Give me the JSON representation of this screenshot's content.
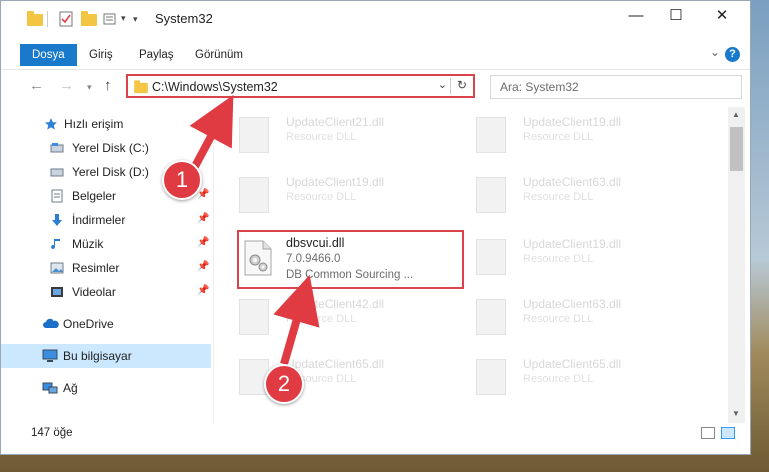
{
  "window": {
    "title": "System32",
    "minimize": "—",
    "maximize": "☐",
    "close": "✕"
  },
  "ribbon": {
    "tabs": [
      {
        "label": "Dosya",
        "active": true
      },
      {
        "label": "Giriş"
      },
      {
        "label": "Paylaş"
      },
      {
        "label": "Görünüm"
      }
    ],
    "help": "?"
  },
  "address": {
    "path": "C:\\Windows\\System32",
    "search_placeholder": "Ara: System32"
  },
  "sidebar": {
    "items": [
      {
        "label": "Hızlı erişim",
        "icon": "star-icon"
      },
      {
        "label": "Yerel Disk (C:)",
        "icon": "drive-icon"
      },
      {
        "label": "Yerel Disk (D:)",
        "icon": "drive-icon"
      },
      {
        "label": "Belgeler",
        "icon": "documents-icon",
        "pinned": true
      },
      {
        "label": "İndirmeler",
        "icon": "download-icon",
        "pinned": true
      },
      {
        "label": "Müzik",
        "icon": "music-icon",
        "pinned": true
      },
      {
        "label": "Resimler",
        "icon": "pictures-icon",
        "pinned": true
      },
      {
        "label": "Videolar",
        "icon": "videos-icon",
        "pinned": true
      },
      {
        "label": "OneDrive",
        "icon": "cloud-icon"
      },
      {
        "label": "Bu bilgisayar",
        "icon": "computer-icon",
        "selected": true
      },
      {
        "label": "Ağ",
        "icon": "network-icon"
      }
    ]
  },
  "files": {
    "left": [
      {
        "name": "UpdateClient21.dll",
        "desc": "Resource DLL"
      },
      {
        "name": "UpdateClient19.dll",
        "desc": "Resource DLL"
      },
      {
        "name": "dbsvcui.dll",
        "version": "7.0.9466.0",
        "desc": "DB Common Sourcing ...",
        "focus": true
      },
      {
        "name": "UpdateClient42.dll",
        "desc": "Resource DLL"
      },
      {
        "name": "UpdateClient65.dll",
        "desc": "Resource DLL"
      }
    ],
    "right": [
      {
        "name": "UpdateClient19.dll",
        "desc": "Resource DLL"
      },
      {
        "name": "UpdateClient63.dll",
        "desc": "Resource DLL"
      },
      {
        "name": "UpdateClient19.dll",
        "desc": "Resource DLL"
      },
      {
        "name": "UpdateClient63.dll",
        "desc": "Resource DLL"
      },
      {
        "name": "UpdateClient65.dll",
        "desc": "Resource DLL"
      }
    ]
  },
  "status": {
    "count": "147 öğe"
  },
  "annotations": {
    "step1": "1",
    "step2": "2"
  },
  "colors": {
    "accent": "#1979ca",
    "highlight": "#d9434b",
    "selected": "#cce8ff"
  }
}
